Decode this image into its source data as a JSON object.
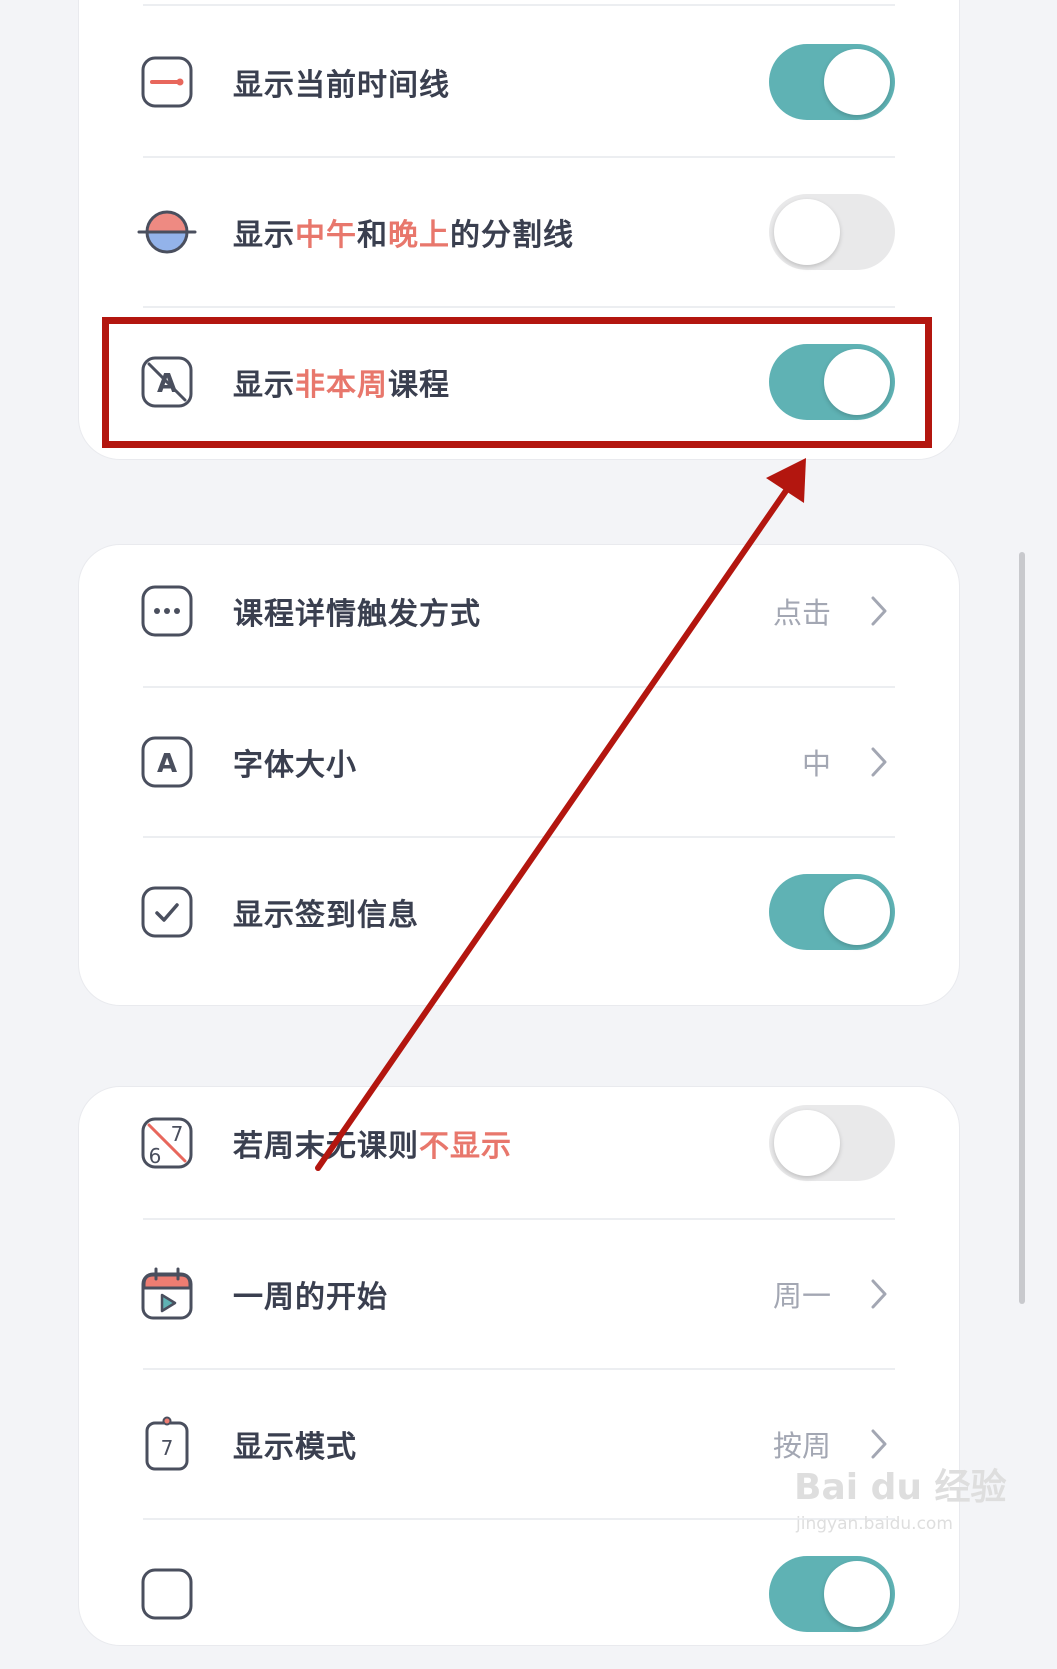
{
  "settings": {
    "current_time_line": {
      "label": "显示当前时间线",
      "enabled": true
    },
    "noon_evening_divider": {
      "label_a": "显示",
      "label_b": "中午",
      "label_c": "和",
      "label_d": "晚上",
      "label_e": "的分割线",
      "enabled": false
    },
    "non_current_week": {
      "label_a": "显示",
      "label_b": "非本周",
      "label_c": "课程",
      "enabled": true
    },
    "course_detail_trigger": {
      "label": "课程详情触发方式",
      "value": "点击"
    },
    "font_size": {
      "label": "字体大小",
      "value": "中"
    },
    "show_checkin": {
      "label": "显示签到信息",
      "enabled": true
    },
    "weekend_hide": {
      "label_a": "若周末无课则",
      "label_b": "不显示",
      "enabled": false
    },
    "week_start": {
      "label": "一周的开始",
      "value": "周一"
    },
    "display_mode": {
      "label": "显示模式",
      "value": "按周"
    }
  },
  "icons": {
    "font_letter": "A",
    "weekend_num_6": "6",
    "weekend_num_7": "7",
    "mode_num": "7"
  },
  "watermark": {
    "main": "Bai du 经验",
    "sub": "jingyan.baidu.com"
  },
  "colors": {
    "toggle_on": "#5fb2b4",
    "toggle_off": "#e9e9ea",
    "highlight_text": "#e8776c",
    "annotation_red": "#b3160f"
  }
}
